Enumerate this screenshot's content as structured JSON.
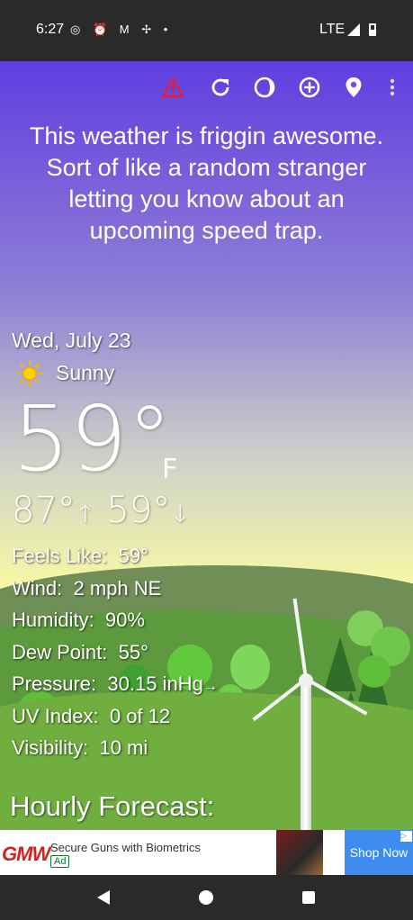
{
  "status_bar": {
    "time": "6:27",
    "notification_icons": "◎ ⏰ M ✢ •",
    "network": "LTE",
    "icons": [
      "instagram-icon",
      "alarm-icon",
      "gmail-icon",
      "pinwheel-icon",
      "dot-icon",
      "signal-icon",
      "battery-icon"
    ]
  },
  "toolbar": {
    "icons": [
      "alert-icon",
      "refresh-icon",
      "theme-icon",
      "add-location-icon",
      "location-pin-icon",
      "more-vert-icon"
    ],
    "alert_color": "#e0203a"
  },
  "quote": "This weather is friggin awesome. Sort of like a random stranger letting you know about an upcoming speed trap.",
  "current": {
    "date": "Wed, July 23",
    "condition": "Sunny",
    "condition_icon": "sun-icon",
    "temperature": "59°",
    "unit": "F",
    "high": "87°",
    "high_arrow": "↑",
    "low": "59°",
    "low_arrow": "↓"
  },
  "details": [
    {
      "label": "Feels Like:",
      "value": "59°",
      "trend": ""
    },
    {
      "label": "Wind:",
      "value": "2 mph NE",
      "trend": ""
    },
    {
      "label": "Humidity:",
      "value": "90%",
      "trend": ""
    },
    {
      "label": "Dew Point:",
      "value": "55°",
      "trend": ""
    },
    {
      "label": "Pressure:",
      "value": "30.15 inHg",
      "trend": "→"
    },
    {
      "label": "UV Index:",
      "value": "0 of 12",
      "trend": ""
    },
    {
      "label": "Visibility:",
      "value": "10 mi",
      "trend": ""
    }
  ],
  "hourly_heading": "Hourly Forecast:",
  "ad": {
    "logo": "GMW",
    "title": "Secure Guns with Biometrics",
    "badge": "Ad",
    "cta": "Shop Now",
    "choices": "▷"
  },
  "navbar": {
    "icons": [
      "back-icon",
      "home-icon",
      "recents-icon"
    ]
  },
  "colors": {
    "sky_top": "#5f3fe0",
    "sky_bottom": "#f6f7a6",
    "grass": "#6fae3f",
    "cta": "#3f8cf0"
  }
}
